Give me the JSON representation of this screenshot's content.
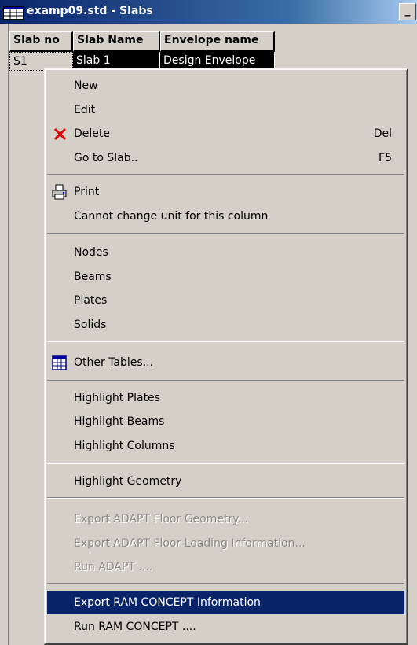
{
  "window": {
    "title": "examp09.std - Slabs",
    "min_button": "_"
  },
  "table": {
    "columns": [
      "Slab no",
      "Slab Name",
      "Envelope name"
    ],
    "rows": [
      [
        "S1",
        "Slab 1",
        "Design Envelope"
      ]
    ]
  },
  "context_menu": {
    "new": "New",
    "edit": "Edit",
    "delete": "Delete",
    "delete_shortcut": "Del",
    "go_to_slab": "Go to Slab..",
    "go_to_slab_shortcut": "F5",
    "print": "Print",
    "cannot_change_unit": "Cannot change unit for this column",
    "nodes": "Nodes",
    "beams": "Beams",
    "plates": "Plates",
    "solids": "Solids",
    "other_tables": "Other Tables...",
    "highlight_plates": "Highlight Plates",
    "highlight_beams": "Highlight Beams",
    "highlight_columns": "Highlight Columns",
    "highlight_geometry": "Highlight Geometry",
    "export_adapt_geometry": "Export ADAPT Floor Geometry...",
    "export_adapt_loading": "Export ADAPT Floor Loading Information...",
    "run_adapt": "Run ADAPT ....",
    "export_ram_concept": "Export RAM CONCEPT Information",
    "run_ram_concept": "Run RAM CONCEPT ...."
  },
  "icons": {
    "window_icon": "table-icon",
    "delete_icon": "red-x-icon",
    "print_icon": "printer-icon",
    "other_tables_icon": "calendar-table-icon"
  },
  "colors": {
    "menu_highlight": "#0a246a",
    "disabled_text": "#8c8a84",
    "delete_icon": "#e00000"
  }
}
